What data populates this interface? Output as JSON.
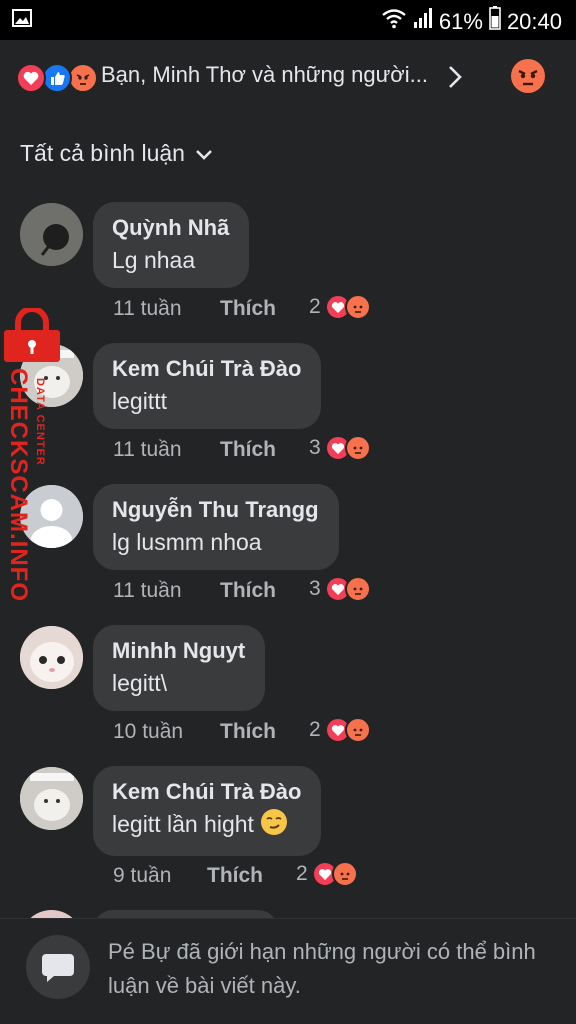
{
  "status_bar": {
    "battery": "61%",
    "time": "20:40"
  },
  "reactions_summary": {
    "text": "Bạn, Minh Thơ và những người..."
  },
  "filter": {
    "label": "Tất cả bình luận"
  },
  "comments": [
    {
      "author": "Quỳnh Nhã",
      "text": "Lg nhaa",
      "time": "11 tuần",
      "like_label": "Thích",
      "reaction_count": "2"
    },
    {
      "author": "Kem Chúi Trà Đào",
      "text": "legittt",
      "time": "11 tuần",
      "like_label": "Thích",
      "reaction_count": "3"
    },
    {
      "author": "Nguyễn Thu Trangg",
      "text": "lg lusmm nhoa",
      "time": "11 tuần",
      "like_label": "Thích",
      "reaction_count": "3"
    },
    {
      "author": "Minhh Nguyt",
      "text": "legitt\\",
      "time": "10 tuần",
      "like_label": "Thích",
      "reaction_count": "2"
    },
    {
      "author": "Kem Chúi Trà Đào",
      "text": "legitt lần hight",
      "time": "9 tuần",
      "like_label": "Thích",
      "reaction_count": "2"
    }
  ],
  "restriction_notice": {
    "text": "Pé Bự đã giới hạn những người có thể bình luận về bài viết này."
  },
  "watermark": {
    "main": "CHECKSCAM.INFO",
    "sub": "DATA CENTER"
  },
  "colors": {
    "background": "#232425",
    "bubble": "#3a3b3c",
    "love": "#f33e58",
    "like": "#1877f2",
    "angry": "#f7714c"
  }
}
